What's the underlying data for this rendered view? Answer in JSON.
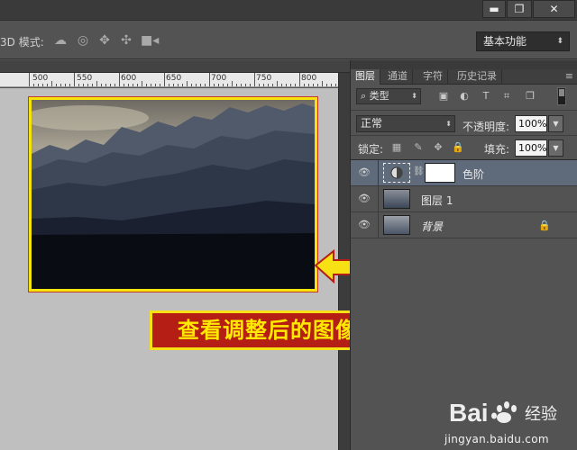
{
  "window": {
    "min_label": "▬",
    "restore_label": "❐",
    "close_label": "✕"
  },
  "options_bar": {
    "mode_3d": "3D 模式:",
    "icons": [
      "orbit-3d-icon",
      "roll-3d-icon",
      "pan-3d-icon",
      "slide-3d-icon",
      "scale-3d-icon"
    ],
    "workspace": "基本功能"
  },
  "ruler": {
    "labels": [
      "500",
      "550",
      "600",
      "650",
      "700",
      "750",
      "800"
    ]
  },
  "callout": {
    "text": "查看调整后的图像效果",
    "bg_color": "#b41e15",
    "text_color": "#ffe900"
  },
  "panel": {
    "tabs": [
      "图层",
      "通道",
      "字符",
      "历史记录"
    ],
    "active_tab": "图层",
    "menu_icon": "≡",
    "filter_kind": "类型",
    "blend_mode": "正常",
    "opacity_label": "不透明度:",
    "opacity_value": "100%",
    "lock_label": "锁定:",
    "fill_label": "填充:",
    "fill_value": "100%",
    "layers": [
      {
        "name": "色阶",
        "type": "adjustment",
        "selected": true
      },
      {
        "name": "图层 1",
        "type": "pixel",
        "selected": false
      },
      {
        "name": "背景",
        "type": "background",
        "selected": false,
        "locked": true
      }
    ]
  },
  "watermark": {
    "brand": "Bai",
    "brand2": "经验",
    "url": "jingyan.baidu.com"
  }
}
